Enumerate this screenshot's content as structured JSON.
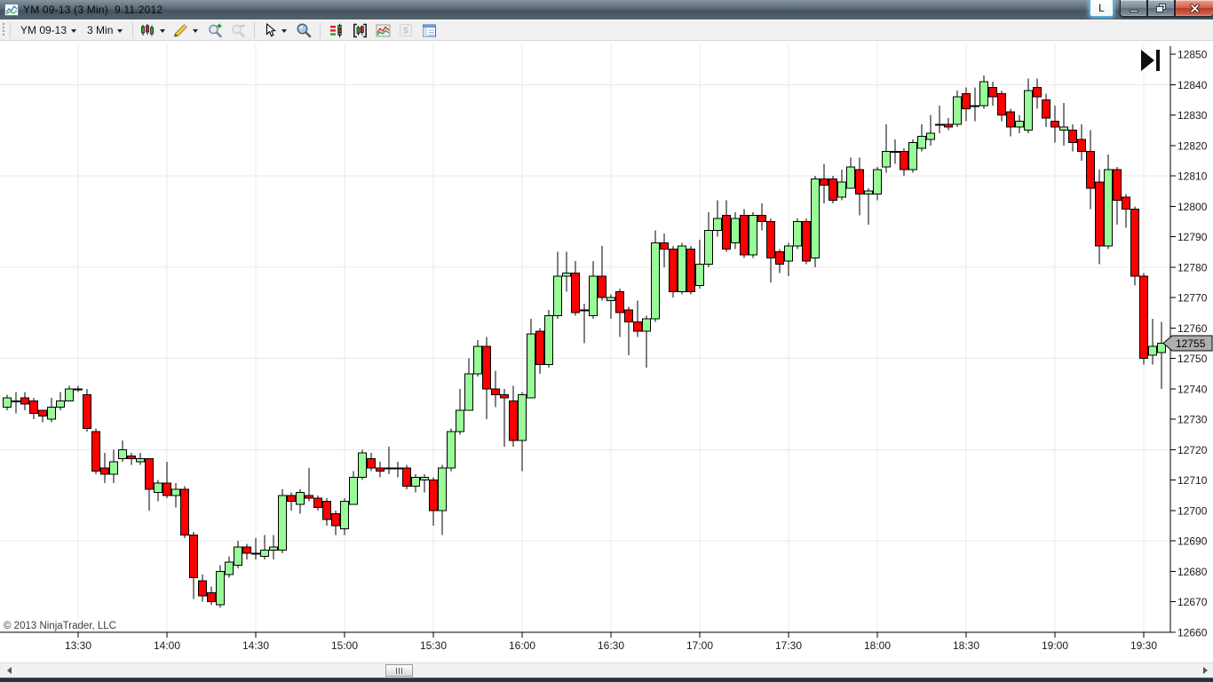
{
  "window": {
    "title": "YM 09-13 (3 Min)  9.11.2012",
    "link_button_label": "L",
    "buttons": [
      "minimize",
      "restore",
      "close"
    ]
  },
  "toolbar": {
    "instrument": "YM 09-13",
    "interval": "3 Min",
    "icons": [
      {
        "name": "chart-style-icon",
        "enabled": true,
        "has_dropdown": true
      },
      {
        "name": "drawing-tools-pencil-icon",
        "enabled": true,
        "has_dropdown": true
      },
      {
        "name": "zoom-in-icon",
        "enabled": true
      },
      {
        "name": "zoom-out-icon",
        "enabled": false
      },
      {
        "name": "cursor-icon",
        "enabled": true,
        "has_dropdown": true
      },
      {
        "name": "zoom-window-icon",
        "enabled": true
      },
      {
        "name": "chart-trader-icon",
        "enabled": true
      },
      {
        "name": "data-series-icon",
        "enabled": true
      },
      {
        "name": "indicators-icon",
        "enabled": true
      },
      {
        "name": "strategies-dollar-icon",
        "enabled": false
      },
      {
        "name": "properties-icon",
        "enabled": true
      }
    ]
  },
  "colors": {
    "up_candle": "#98FB98",
    "down_candle": "#FE0000",
    "candle_outline": "#000000",
    "grid": "#e9e9e9",
    "axis_text": "#1a1a1a",
    "marker_fill": "#aeaeae"
  },
  "chart_data": {
    "type": "candlestick",
    "title": "YM 09-13 (3 Min)  9.11.2012",
    "copyright": "© 2013 NinjaTrader, LLC",
    "last_price": "12755",
    "y_axis": {
      "min": 12660,
      "max": 12850,
      "tick_step": 10,
      "grid_step": 30,
      "side": "right"
    },
    "x_axis": {
      "tick_labels": [
        "13:30",
        "14:00",
        "14:30",
        "15:00",
        "15:30",
        "16:00",
        "16:30",
        "17:00",
        "17:30",
        "18:00",
        "18:30",
        "19:00",
        "19:30"
      ]
    },
    "candles": [
      [
        "13:06",
        12734,
        12738,
        12733,
        12737
      ],
      [
        "13:09",
        12736,
        12739,
        12732,
        12736
      ],
      [
        "13:12",
        12737,
        12739,
        12733,
        12735
      ],
      [
        "13:15",
        12736,
        12737,
        12730,
        12732
      ],
      [
        "13:18",
        12733,
        12733,
        12729,
        12731
      ],
      [
        "13:21",
        12730,
        12737,
        12729,
        12734
      ],
      [
        "13:24",
        12734,
        12739,
        12733,
        12736
      ],
      [
        "13:27",
        12736,
        12741,
        12736,
        12740
      ],
      [
        "13:30",
        12740,
        12741,
        12739,
        12740
      ],
      [
        "13:33",
        12738,
        12740,
        12726,
        12727
      ],
      [
        "13:36",
        12726,
        12727,
        12712,
        12713
      ],
      [
        "13:39",
        12714,
        12719,
        12709,
        12712
      ],
      [
        "13:42",
        12712,
        12720,
        12709,
        12716
      ],
      [
        "13:45",
        12717,
        12723,
        12716,
        12720
      ],
      [
        "13:48",
        12718,
        12719,
        12715,
        12717
      ],
      [
        "13:51",
        12716,
        12719,
        12715,
        12717
      ],
      [
        "13:54",
        12717,
        12717,
        12700,
        12707
      ],
      [
        "13:57",
        12706,
        12710,
        12703,
        12709
      ],
      [
        "14:00",
        12709,
        12716,
        12704,
        12705
      ],
      [
        "14:03",
        12705,
        12709,
        12701,
        12707
      ],
      [
        "14:06",
        12707,
        12708,
        12691,
        12692
      ],
      [
        "14:09",
        12692,
        12693,
        12671,
        12678
      ],
      [
        "14:12",
        12677,
        12679,
        12670,
        12672
      ],
      [
        "14:15",
        12673,
        12675,
        12669,
        12670
      ],
      [
        "14:18",
        12669,
        12682,
        12668,
        12680
      ],
      [
        "14:21",
        12679,
        12685,
        12678,
        12683
      ],
      [
        "14:24",
        12682,
        12690,
        12681,
        12688
      ],
      [
        "14:27",
        12688,
        12689,
        12684,
        12686
      ],
      [
        "14:30",
        12686,
        12691,
        12684,
        12686
      ],
      [
        "14:33",
        12685,
        12692,
        12684,
        12687
      ],
      [
        "14:36",
        12687,
        12692,
        12684,
        12688
      ],
      [
        "14:39",
        12687,
        12707,
        12686,
        12705
      ],
      [
        "14:42",
        12705,
        12706,
        12700,
        12703
      ],
      [
        "14:45",
        12702,
        12707,
        12699,
        12706
      ],
      [
        "14:48",
        12705,
        12714,
        12703,
        12704
      ],
      [
        "14:51",
        12704,
        12705,
        12700,
        12701
      ],
      [
        "14:54",
        12703,
        12704,
        12695,
        12697
      ],
      [
        "14:57",
        12699,
        12700,
        12692,
        12695
      ],
      [
        "15:00",
        12694,
        12704,
        12692,
        12703
      ],
      [
        "15:03",
        12702,
        12713,
        12702,
        12711
      ],
      [
        "15:06",
        12711,
        12720,
        12710,
        12719
      ],
      [
        "15:09",
        12717,
        12719,
        12713,
        12714
      ],
      [
        "15:12",
        12714,
        12716,
        12711,
        12713
      ],
      [
        "15:15",
        12714,
        12721,
        12712,
        12714
      ],
      [
        "15:18",
        12714,
        12716,
        12711,
        12714
      ],
      [
        "15:21",
        12714,
        12715,
        12707,
        12708
      ],
      [
        "15:24",
        12708,
        12712,
        12706,
        12711
      ],
      [
        "15:27",
        12710,
        12712,
        12706,
        12711
      ],
      [
        "15:30",
        12710,
        12711,
        12695,
        12700
      ],
      [
        "15:33",
        12700,
        12715,
        12692,
        12714
      ],
      [
        "15:36",
        12714,
        12727,
        12713,
        12726
      ],
      [
        "15:39",
        12726,
        12740,
        12725,
        12733
      ],
      [
        "15:42",
        12733,
        12750,
        12733,
        12745
      ],
      [
        "15:45",
        12745,
        12756,
        12744,
        12754
      ],
      [
        "15:48",
        12754,
        12757,
        12730,
        12740
      ],
      [
        "15:51",
        12740,
        12746,
        12734,
        12738
      ],
      [
        "15:54",
        12738,
        12740,
        12721,
        12737
      ],
      [
        "15:57",
        12736,
        12741,
        12721,
        12723
      ],
      [
        "16:00",
        12723,
        12739,
        12713,
        12738
      ],
      [
        "16:03",
        12737,
        12763,
        12737,
        12758
      ],
      [
        "16:06",
        12759,
        12760,
        12745,
        12748
      ],
      [
        "16:09",
        12748,
        12766,
        12747,
        12764
      ],
      [
        "16:12",
        12764,
        12785,
        12763,
        12777
      ],
      [
        "16:15",
        12777,
        12785,
        12772,
        12778
      ],
      [
        "16:18",
        12778,
        12782,
        12764,
        12765
      ],
      [
        "16:21",
        12766,
        12768,
        12755,
        12766
      ],
      [
        "16:24",
        12764,
        12782,
        12763,
        12777
      ],
      [
        "16:27",
        12777,
        12787,
        12769,
        12770
      ],
      [
        "16:30",
        12769,
        12771,
        12763,
        12770
      ],
      [
        "16:33",
        12772,
        12773,
        12757,
        12765
      ],
      [
        "16:36",
        12766,
        12767,
        12751,
        12762
      ],
      [
        "16:39",
        12762,
        12769,
        12757,
        12759
      ],
      [
        "16:42",
        12759,
        12764,
        12747,
        12763
      ],
      [
        "16:45",
        12763,
        12792,
        12762,
        12788
      ],
      [
        "16:48",
        12788,
        12791,
        12780,
        12786
      ],
      [
        "16:51",
        12786,
        12787,
        12770,
        12772
      ],
      [
        "16:54",
        12772,
        12788,
        12771,
        12787
      ],
      [
        "16:57",
        12786,
        12787,
        12771,
        12772
      ],
      [
        "17:00",
        12774,
        12789,
        12773,
        12781
      ],
      [
        "17:03",
        12781,
        12798,
        12780,
        12792
      ],
      [
        "17:06",
        12792,
        12802,
        12790,
        12796
      ],
      [
        "17:09",
        12797,
        12802,
        12785,
        12786
      ],
      [
        "17:12",
        12788,
        12798,
        12786,
        12796
      ],
      [
        "17:15",
        12797,
        12799,
        12783,
        12784
      ],
      [
        "17:18",
        12784,
        12798,
        12783,
        12797
      ],
      [
        "17:21",
        12797,
        12801,
        12792,
        12795
      ],
      [
        "17:24",
        12795,
        12796,
        12775,
        12783
      ],
      [
        "17:27",
        12785,
        12786,
        12778,
        12781
      ],
      [
        "17:30",
        12782,
        12788,
        12777,
        12787
      ],
      [
        "17:33",
        12787,
        12796,
        12786,
        12795
      ],
      [
        "17:36",
        12795,
        12796,
        12781,
        12782
      ],
      [
        "17:39",
        12783,
        12810,
        12780,
        12809
      ],
      [
        "17:42",
        12809,
        12814,
        12801,
        12807
      ],
      [
        "17:45",
        12809,
        12810,
        12801,
        12802
      ],
      [
        "17:48",
        12803,
        12812,
        12802,
        12808
      ],
      [
        "17:51",
        12806,
        12816,
        12806,
        12813
      ],
      [
        "17:54",
        12812,
        12816,
        12797,
        12804
      ],
      [
        "17:57",
        12804,
        12806,
        12794,
        12805
      ],
      [
        "18:00",
        12804,
        12813,
        12802,
        12812
      ],
      [
        "18:03",
        12813,
        12827,
        12811,
        12818
      ],
      [
        "18:06",
        12818,
        12822,
        12814,
        12818
      ],
      [
        "18:09",
        12818,
        12819,
        12810,
        12812
      ],
      [
        "18:12",
        12812,
        12822,
        12811,
        12821
      ],
      [
        "18:15",
        12819,
        12827,
        12818,
        12823
      ],
      [
        "18:18",
        12822,
        12830,
        12820,
        12824
      ],
      [
        "18:21",
        12827,
        12833,
        12824,
        12827
      ],
      [
        "18:24",
        12827,
        12829,
        12825,
        12826
      ],
      [
        "18:27",
        12827,
        12838,
        12826,
        12836
      ],
      [
        "18:30",
        12837,
        12839,
        12828,
        12832
      ],
      [
        "18:33",
        12833,
        12839,
        12828,
        12833
      ],
      [
        "18:36",
        12833,
        12843,
        12832,
        12841
      ],
      [
        "18:39",
        12839,
        12841,
        12833,
        12836
      ],
      [
        "18:42",
        12837,
        12838,
        12828,
        12830
      ],
      [
        "18:45",
        12831,
        12832,
        12823,
        12826
      ],
      [
        "18:48",
        12826,
        12830,
        12824,
        12828
      ],
      [
        "18:51",
        12825,
        12842,
        12824,
        12838
      ],
      [
        "18:54",
        12839,
        12842,
        12832,
        12836
      ],
      [
        "18:57",
        12835,
        12837,
        12826,
        12829
      ],
      [
        "19:00",
        12828,
        12833,
        12821,
        12826
      ],
      [
        "19:03",
        12825,
        12834,
        12820,
        12826
      ],
      [
        "19:06",
        12825,
        12827,
        12818,
        12821
      ],
      [
        "19:09",
        12822,
        12827,
        12815,
        12818
      ],
      [
        "19:12",
        12818,
        12825,
        12799,
        12806
      ],
      [
        "19:15",
        12808,
        12812,
        12781,
        12787
      ],
      [
        "19:18",
        12787,
        12817,
        12786,
        12812
      ],
      [
        "19:21",
        12812,
        12813,
        12794,
        12802
      ],
      [
        "19:24",
        12803,
        12804,
        12793,
        12799
      ],
      [
        "19:27",
        12799,
        12800,
        12774,
        12777
      ],
      [
        "19:30",
        12777,
        12778,
        12748,
        12750
      ],
      [
        "19:33",
        12751,
        12763,
        12748,
        12754
      ],
      [
        "19:36",
        12752,
        12762,
        12740,
        12755
      ]
    ]
  }
}
